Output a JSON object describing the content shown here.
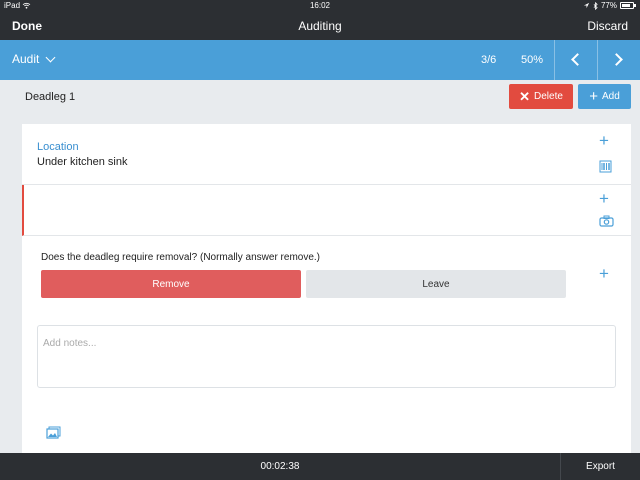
{
  "status_bar": {
    "device": "iPad",
    "time": "16:02",
    "battery": "77%",
    "battery_level": 0.77
  },
  "nav": {
    "done_label": "Done",
    "title": "Auditing",
    "discard_label": "Discard"
  },
  "audit_bar": {
    "select_label": "Audit",
    "progress_count": "3/6",
    "progress_percent": "50%"
  },
  "item": {
    "title": "Deadleg 1",
    "delete_label": "Delete",
    "add_label": "Add"
  },
  "location": {
    "label": "Location",
    "value": "Under kitchen sink"
  },
  "question": {
    "text": "Does the deadleg require removal? (Normally answer remove.)",
    "options": [
      "Remove",
      "Leave"
    ],
    "selected": "Remove"
  },
  "notes": {
    "placeholder": "Add notes..."
  },
  "footer": {
    "timer": "00:02:38",
    "export_label": "Export"
  },
  "colors": {
    "accent": "#4a9fd8",
    "danger": "#e24b3f",
    "selected_answer": "#e05d5d",
    "dark_bar": "#2c2f33"
  }
}
